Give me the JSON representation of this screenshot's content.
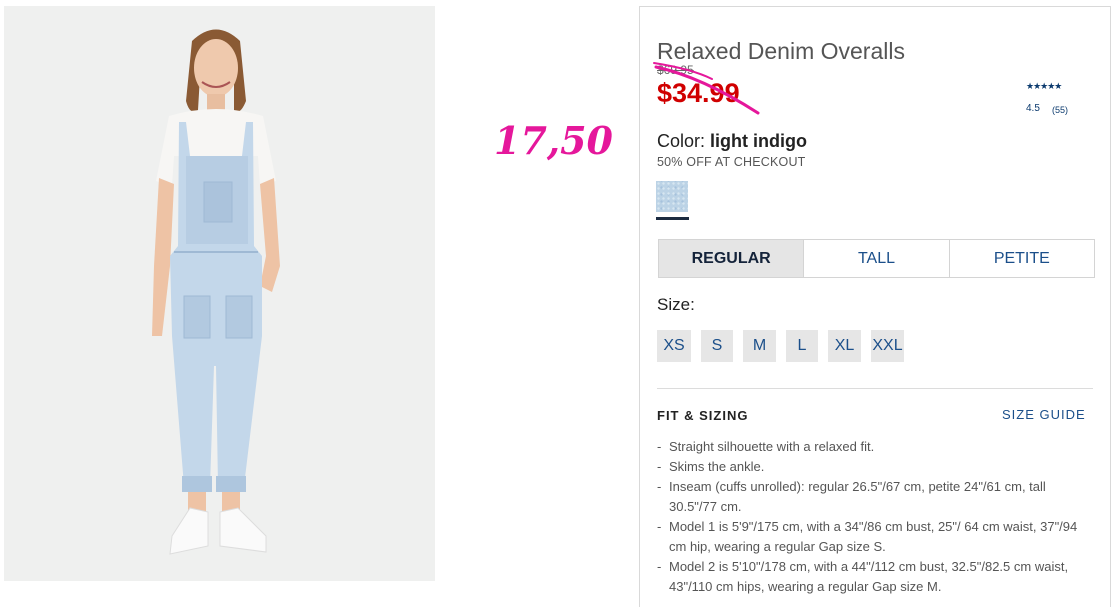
{
  "product": {
    "title": "Relaxed Denim Overalls",
    "original_price": "$69.95",
    "sale_price": "$34.99",
    "rating_stars": "★★★★★",
    "rating_value": "4.5",
    "review_count": "(55)",
    "color_label": "Color:",
    "color_value": "light indigo",
    "checkout_note": "50% OFF AT CHECKOUT",
    "swatch_color": "#bcd3e6"
  },
  "annotation": {
    "handwritten_price": "17,50",
    "color": "#e5179b"
  },
  "fit_tabs": [
    {
      "label": "REGULAR",
      "active": true
    },
    {
      "label": "TALL",
      "active": false
    },
    {
      "label": "PETITE",
      "active": false
    }
  ],
  "size": {
    "label": "Size:",
    "options": [
      "XS",
      "S",
      "M",
      "L",
      "XL",
      "XXL"
    ]
  },
  "fit_sizing": {
    "heading": "FIT & SIZING",
    "size_guide": "SIZE GUIDE",
    "bullets": [
      "Straight silhouette with a relaxed fit.",
      "Skims the ankle.",
      "Inseam (cuffs unrolled): regular 26.5\"/67 cm, petite 24\"/61 cm, tall 30.5\"/77 cm.",
      "Model 1 is 5'9\"/175 cm, with a 34\"/86 cm bust, 25\"/ 64 cm waist, 37\"/94 cm hip, wearing a regular Gap size S.",
      "Model 2 is 5'10\"/178 cm, with a 44\"/112 cm bust, 32.5\"/82.5 cm waist, 43\"/110 cm hips, wearing a regular Gap size M."
    ]
  },
  "colors": {
    "link": "#1b4f8a",
    "sale": "#d00000",
    "active_tab_bg": "#e5e5e5"
  }
}
